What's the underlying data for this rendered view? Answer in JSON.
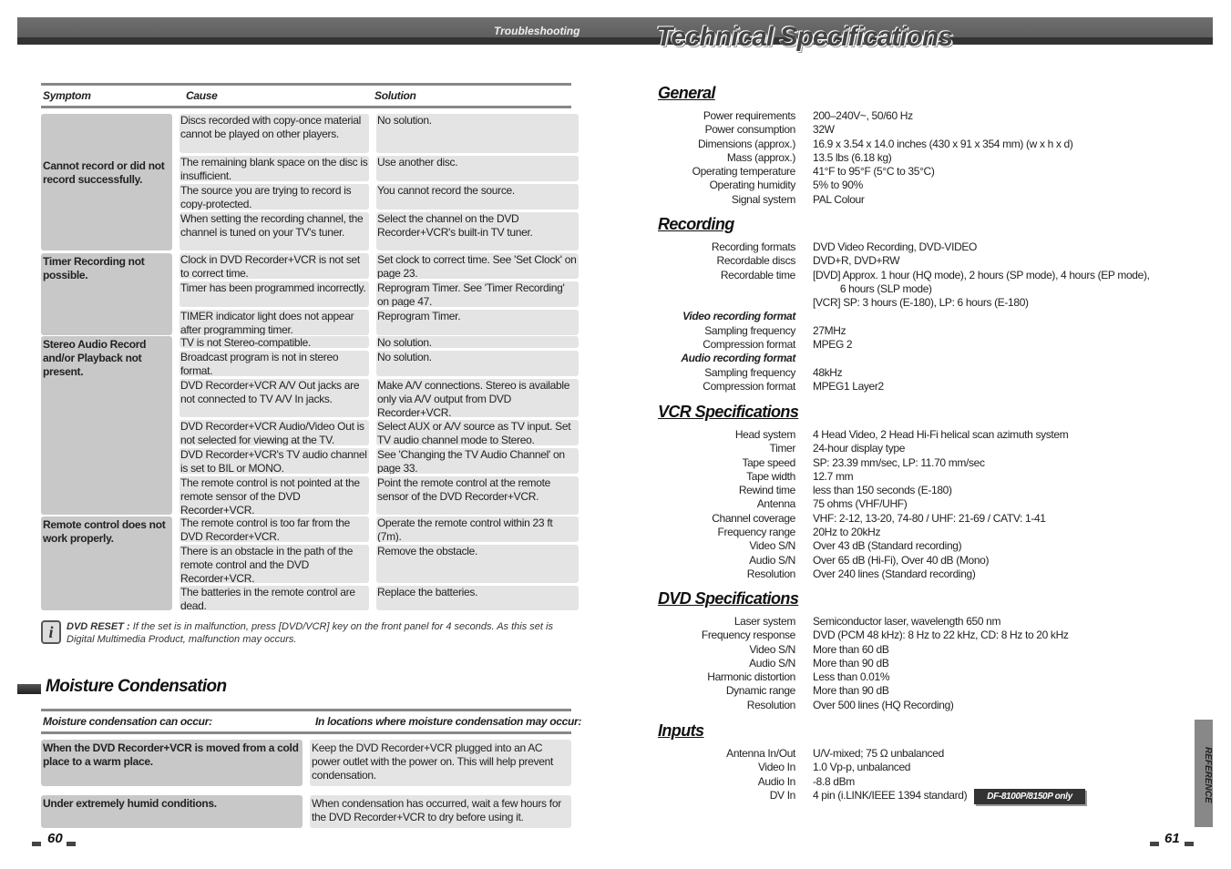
{
  "header": {
    "left_title": "Troubleshooting",
    "right_title": "Technical Specifications"
  },
  "troubleshooting": {
    "headers": {
      "symptom": "Symptom",
      "cause": "Cause",
      "solution": "Solution"
    },
    "groups": [
      {
        "symptom": "Cannot record or did not record successfully.",
        "rows": [
          {
            "cause": "Discs recorded with copy-once material cannot be played on other players.",
            "solution": "No solution."
          },
          {
            "cause": "The remaining blank space on the disc is insufficient.",
            "solution": "Use another disc."
          },
          {
            "cause": "The source you are trying to record is copy-protected.",
            "solution": "You cannot record the source."
          },
          {
            "cause": "When setting the recording channel, the channel is tuned on your TV's tuner.",
            "solution": "Select the channel on the DVD Recorder+VCR's built-in TV tuner."
          }
        ]
      },
      {
        "symptom": "Timer Recording not possible.",
        "rows": [
          {
            "cause": "Clock in DVD Recorder+VCR is not set to correct time.",
            "solution": "Set clock to correct time. See 'Set Clock' on page 23."
          },
          {
            "cause": "Timer has been programmed incorrectly.",
            "solution": "Reprogram Timer. See 'Timer Recording' on page 47."
          },
          {
            "cause": "TIMER indicator light does not appear after programming timer.",
            "solution": "Reprogram Timer."
          }
        ]
      },
      {
        "symptom": "Stereo Audio Record and/or Playback not present.",
        "rows": [
          {
            "cause": "TV is not Stereo-compatible.",
            "solution": "No solution."
          },
          {
            "cause": "Broadcast program is not in stereo format.",
            "solution": "No solution."
          },
          {
            "cause": "DVD Recorder+VCR A/V Out jacks are not connected to TV A/V In jacks.",
            "solution": "Make A/V connections. Stereo is available only via A/V output from DVD Recorder+VCR."
          },
          {
            "cause": "DVD Recorder+VCR Audio/Video Out is not selected for viewing at the TV.",
            "solution": "Select AUX or A/V source as TV input. Set TV audio channel mode to Stereo."
          },
          {
            "cause": "DVD Recorder+VCR's TV audio channel is set to BIL or MONO.",
            "solution": "See 'Changing the TV Audio Channel' on page 33."
          },
          {
            "cause": "The remote control is not pointed at the remote sensor of the DVD Recorder+VCR.",
            "solution": "Point the remote control at the remote sensor of the DVD Recorder+VCR."
          }
        ]
      },
      {
        "symptom": "Remote control does not work properly.",
        "rows": [
          {
            "cause": "The remote control is too far from the DVD Recorder+VCR.",
            "solution": "Operate the remote control within 23 ft (7m)."
          },
          {
            "cause": "There is an obstacle in the path of the remote control and the DVD Recorder+VCR.",
            "solution": "Remove the obstacle."
          },
          {
            "cause": "The batteries in the remote control are dead.",
            "solution": "Replace the batteries."
          }
        ]
      }
    ]
  },
  "note": {
    "label": "DVD RESET :",
    "text": "If the set is in malfunction, press [DVD/VCR] key on the front panel for 4 seconds. As this set is Digital Multimedia Product, malfunction may occurs."
  },
  "moisture": {
    "title": "Moisture Condensation",
    "headers": {
      "a": "Moisture condensation can occur:",
      "b": "In locations where moisture condensation may occur:"
    },
    "rows": [
      {
        "a": "When the DVD Recorder+VCR is moved from a cold place to a warm place.",
        "b": "Keep the DVD Recorder+VCR plugged into an AC power outlet with the power on. This will help prevent condensation."
      },
      {
        "a": "Under extremely humid conditions.",
        "b": "When condensation has occurred, wait a few hours for the DVD Recorder+VCR to dry before using it."
      }
    ]
  },
  "specs": {
    "general": {
      "title": "General",
      "rows": [
        {
          "label": "Power requirements",
          "value": "200–240V~, 50/60 Hz"
        },
        {
          "label": "Power consumption",
          "value": "32W"
        },
        {
          "label": "Dimensions (approx.)",
          "value": "16.9 x 3.54 x 14.0 inches (430 x 91 x 354 mm) (w x h x d)"
        },
        {
          "label": "Mass (approx.)",
          "value": "13.5 lbs (6.18 kg)"
        },
        {
          "label": "Operating temperature",
          "value": "41°F to 95°F (5°C to 35°C)"
        },
        {
          "label": "Operating humidity",
          "value": "5% to 90%"
        },
        {
          "label": "Signal system",
          "value": "PAL Colour"
        }
      ]
    },
    "recording": {
      "title": "Recording",
      "rows": [
        {
          "label": "Recording formats",
          "value": "DVD Video Recording, DVD-VIDEO"
        },
        {
          "label": "Recordable discs",
          "value": "DVD+R, DVD+RW"
        },
        {
          "label": "Recordable time",
          "value": "[DVD] Approx. 1 hour (HQ mode), 2 hours (SP mode), 4 hours (EP mode),"
        },
        {
          "label": "",
          "value": "          6 hours (SLP mode)"
        },
        {
          "label": "",
          "value": "[VCR] SP: 3 hours (E-180), LP: 6 hours (E-180)"
        },
        {
          "label": "Video recording format",
          "value": "",
          "sub": true
        },
        {
          "label": "Sampling frequency",
          "value": "27MHz"
        },
        {
          "label": "Compression format",
          "value": "MPEG 2"
        },
        {
          "label": "Audio recording format",
          "value": "",
          "sub": true
        },
        {
          "label": "Sampling frequency",
          "value": "48kHz"
        },
        {
          "label": "Compression format",
          "value": "MPEG1 Layer2"
        }
      ]
    },
    "vcr": {
      "title": "VCR Specifications",
      "rows": [
        {
          "label": "Head system",
          "value": "4 Head Video, 2 Head Hi-Fi helical scan azimuth system"
        },
        {
          "label": "Timer",
          "value": "24-hour display type"
        },
        {
          "label": "Tape speed",
          "value": "SP: 23.39 mm/sec, LP: 11.70 mm/sec"
        },
        {
          "label": "Tape width",
          "value": "12.7 mm"
        },
        {
          "label": "Rewind time",
          "value": "less than 150 seconds (E-180)"
        },
        {
          "label": "Antenna",
          "value": "75 ohms (VHF/UHF)"
        },
        {
          "label": "Channel coverage",
          "value": "VHF: 2-12, 13-20, 74-80 / UHF: 21-69 / CATV: 1-41"
        },
        {
          "label": "Frequency range",
          "value": "20Hz to 20kHz"
        },
        {
          "label": "Video S/N",
          "value": "Over 43 dB (Standard recording)"
        },
        {
          "label": "Audio S/N",
          "value": "Over 65 dB (Hi-Fi), Over 40 dB (Mono)"
        },
        {
          "label": "Resolution",
          "value": "Over 240 lines (Standard recording)"
        }
      ]
    },
    "dvd": {
      "title": "DVD Specifications",
      "rows": [
        {
          "label": "Laser system",
          "value": "Semiconductor laser, wavelength 650 nm"
        },
        {
          "label": "Frequency response",
          "value": "DVD (PCM 48 kHz): 8 Hz to 22 kHz, CD: 8 Hz to 20 kHz"
        },
        {
          "label": "Video S/N",
          "value": "More than 60 dB"
        },
        {
          "label": "Audio S/N",
          "value": "More than 90 dB"
        },
        {
          "label": "Harmonic distortion",
          "value": "Less than 0.01%"
        },
        {
          "label": "Dynamic range",
          "value": "More than 90 dB"
        },
        {
          "label": "Resolution",
          "value": "Over 500 lines (HQ Recording)"
        }
      ]
    },
    "inputs": {
      "title": "Inputs",
      "rows": [
        {
          "label": "Antenna In/Out",
          "value": "U/V-mixed; 75 Ω unbalanced"
        },
        {
          "label": "Video In",
          "value": "1.0 Vp-p, unbalanced"
        },
        {
          "label": "Audio In",
          "value": "-8.8 dBm"
        },
        {
          "label": "DV In",
          "value": "4 pin (i.LINK/IEEE 1394 standard)",
          "badge": "DF-8100P/8150P only"
        }
      ]
    }
  },
  "side_tab": "REFERENCE",
  "page_numbers": {
    "left": "60",
    "right": "61"
  }
}
